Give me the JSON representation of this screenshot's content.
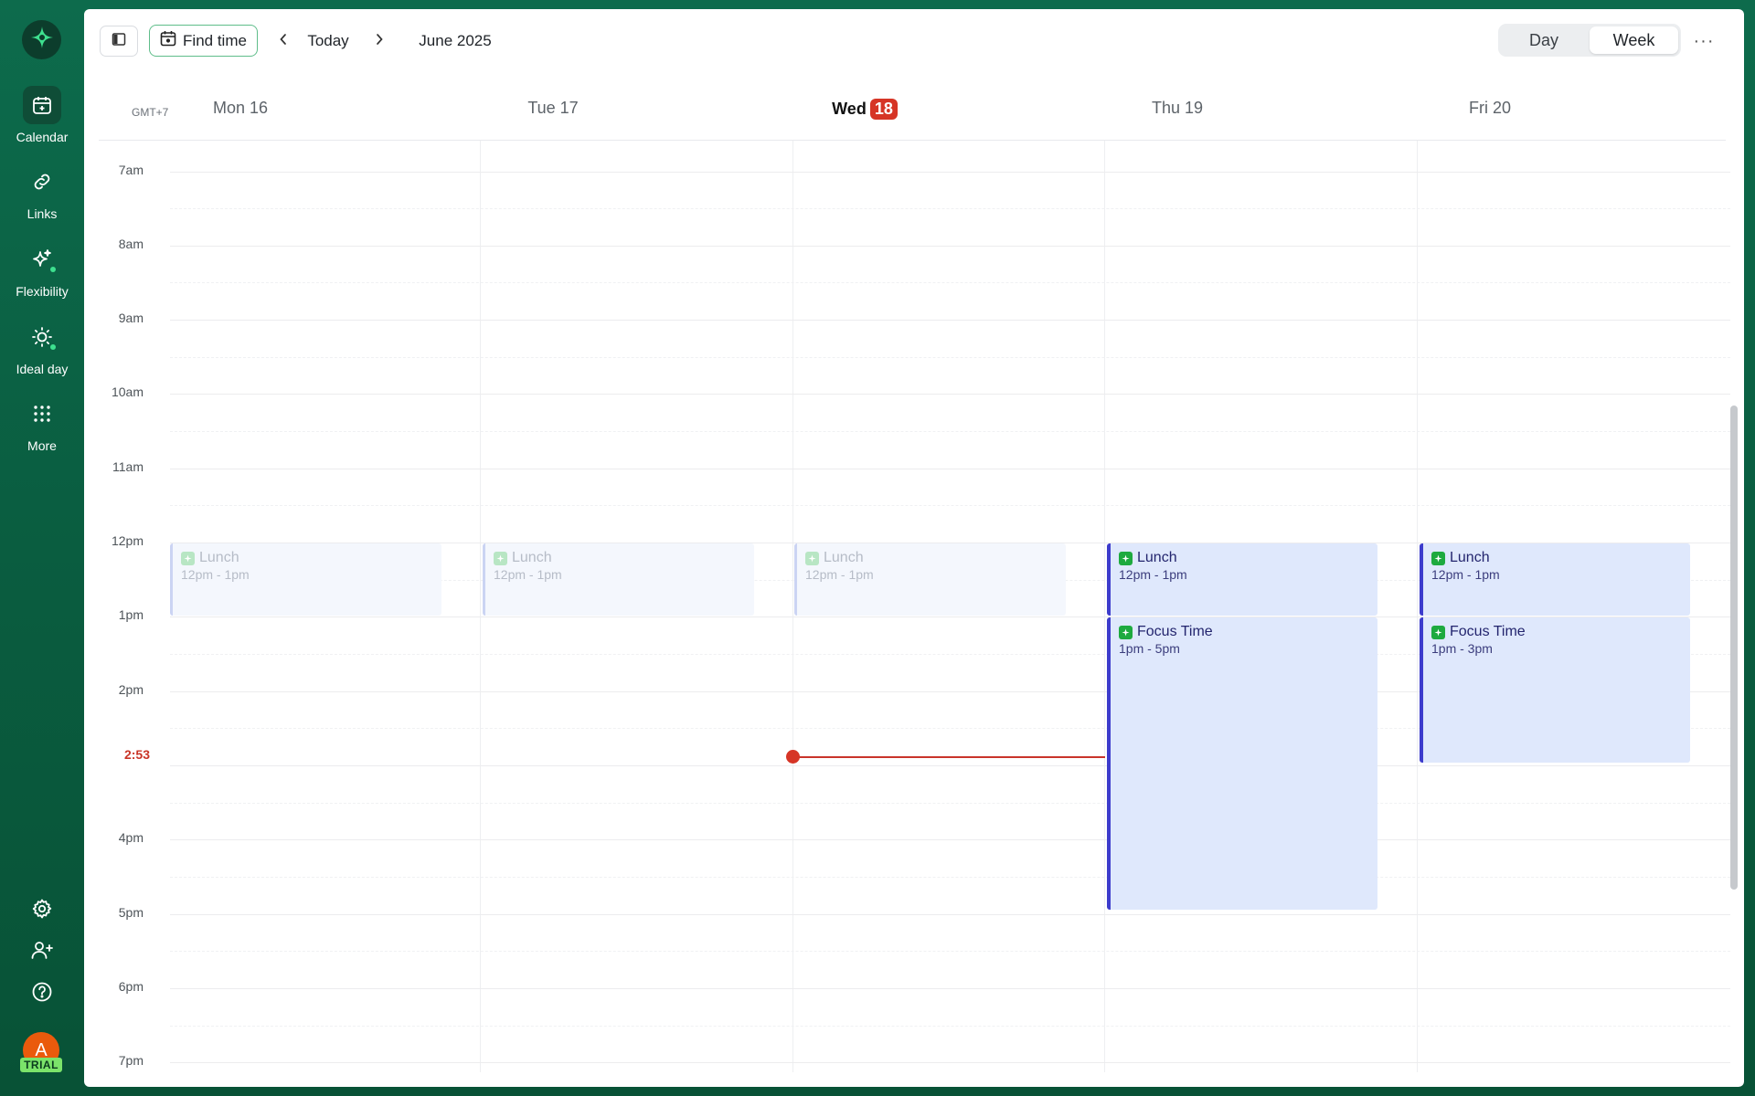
{
  "sidebar": {
    "items": [
      {
        "label": "Calendar",
        "icon": "calendar-icon"
      },
      {
        "label": "Links",
        "icon": "link-icon"
      },
      {
        "label": "Flexibility",
        "icon": "sparkle-icon"
      },
      {
        "label": "Ideal day",
        "icon": "sun-icon"
      },
      {
        "label": "More",
        "icon": "grid-dots-icon"
      }
    ],
    "avatar_initial": "A",
    "trial_badge": "TRIAL"
  },
  "toolbar": {
    "find_time_label": "Find time",
    "today_label": "Today",
    "month_label": "June 2025",
    "view_day_label": "Day",
    "view_week_label": "Week",
    "more_label": "···"
  },
  "calendar": {
    "timezone": "GMT+7",
    "days": [
      {
        "label": "Mon 16"
      },
      {
        "label": "Tue 17"
      },
      {
        "label": "Wed",
        "number": "18"
      },
      {
        "label": "Thu 19"
      },
      {
        "label": "Fri 20"
      }
    ],
    "hours": [
      "7am",
      "8am",
      "9am",
      "10am",
      "11am",
      "12pm",
      "1pm",
      "2pm",
      "4pm",
      "5pm",
      "6pm",
      "7pm"
    ],
    "now_label": "2:53",
    "events": [
      {
        "day": 0,
        "title": "Lunch",
        "time": "12pm - 1pm",
        "past": true
      },
      {
        "day": 1,
        "title": "Lunch",
        "time": "12pm - 1pm",
        "past": true
      },
      {
        "day": 2,
        "title": "Lunch",
        "time": "12pm - 1pm",
        "past": true
      },
      {
        "day": 3,
        "title": "Lunch",
        "time": "12pm - 1pm",
        "past": false
      },
      {
        "day": 3,
        "title": "Focus Time",
        "time": "1pm - 5pm",
        "past": false
      },
      {
        "day": 4,
        "title": "Lunch",
        "time": "12pm - 1pm",
        "past": false
      },
      {
        "day": 4,
        "title": "Focus Time",
        "time": "1pm - 3pm",
        "past": false
      }
    ]
  }
}
